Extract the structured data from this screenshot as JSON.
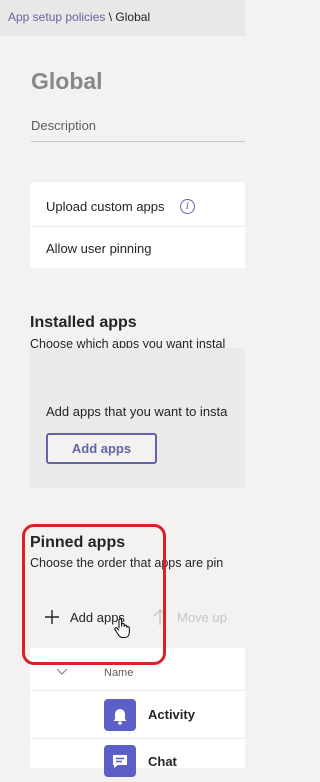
{
  "breadcrumb": {
    "parent": "App setup policies",
    "separator": " \\ ",
    "current": "Global"
  },
  "page_title": "Global",
  "description_label": "Description",
  "settings": [
    {
      "label": "Upload custom apps",
      "has_info": true
    },
    {
      "label": "Allow user pinning",
      "has_info": false
    }
  ],
  "installed": {
    "title": "Installed apps",
    "subtitle": "Choose which apps you want instal",
    "empty_text": "Add apps that you want to insta",
    "add_button": "Add apps"
  },
  "pinned": {
    "title": "Pinned apps",
    "subtitle": "Choose the order that apps are pin",
    "add_button": "Add apps",
    "move_up": "Move up",
    "column_name": "Name",
    "apps": [
      {
        "name": "Activity",
        "icon": "bell-icon"
      },
      {
        "name": "Chat",
        "icon": "chat-icon"
      }
    ]
  },
  "colors": {
    "accent": "#6264a7",
    "highlight": "#d92128"
  }
}
